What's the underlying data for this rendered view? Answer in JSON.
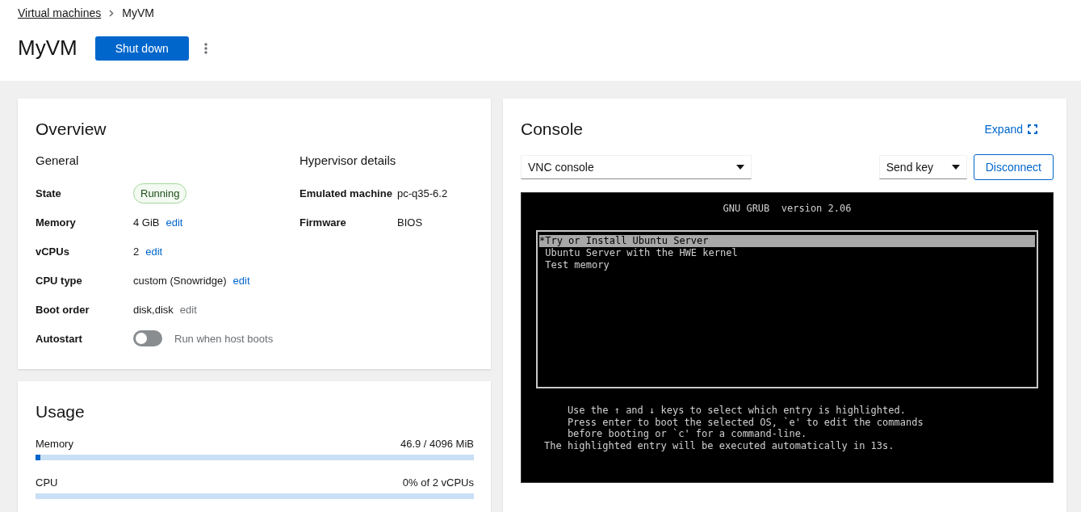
{
  "breadcrumb": [
    {
      "label": "Virtual machines",
      "kind": "link"
    },
    {
      "label": "MyVM",
      "kind": "current"
    }
  ],
  "header": {
    "title": "MyVM",
    "primary_button": "Shut down"
  },
  "overview": {
    "title": "Overview",
    "general": {
      "heading": "General",
      "rows": [
        {
          "kind": "badge",
          "label": "State",
          "value": "Running"
        },
        {
          "kind": "text",
          "label": "Memory",
          "value": "4 GiB",
          "action": "edit",
          "disabled": false
        },
        {
          "kind": "text",
          "label": "vCPUs",
          "value": "2",
          "action": "edit",
          "disabled": false
        },
        {
          "kind": "text",
          "label": "CPU type",
          "value": "custom (Snowridge)",
          "action": "edit",
          "disabled": false
        },
        {
          "kind": "text",
          "label": "Boot order",
          "value": "disk,disk",
          "action": "edit",
          "disabled": true
        },
        {
          "kind": "switch",
          "label": "Autostart",
          "value": "Run when host boots",
          "on": false
        }
      ]
    },
    "hypervisor": {
      "heading": "Hypervisor details",
      "rows": [
        {
          "label": "Emulated machine",
          "value": "pc-q35-6.2"
        },
        {
          "label": "Firmware",
          "value": "BIOS"
        }
      ]
    }
  },
  "usage": {
    "title": "Usage",
    "meters": [
      {
        "name": "Memory",
        "reading": "46.9 / 4096 MiB",
        "level": 0.011
      },
      {
        "name": "CPU",
        "reading": "0% of 2 vCPUs"
      }
    ]
  },
  "console": {
    "title": "Console",
    "expand": "Expand",
    "type_select": "VNC console",
    "send_key": "Send key",
    "disconnect": "Disconnect",
    "screen": {
      "title": "GNU GRUB  version 2.06",
      "entries": [
        {
          "label": "*Try or Install Ubuntu Server",
          "selected": true
        },
        {
          "label": " Ubuntu Server with the HWE kernel",
          "selected": false
        },
        {
          "label": " Test memory",
          "selected": false
        }
      ],
      "help": [
        "    Use the ↑ and ↓ keys to select which entry is highlighted.",
        "    Press enter to boot the selected OS, `e' to edit the commands",
        "    before booting or `c' for a command-line.",
        "The highlighted entry will be executed automatically in 13s."
      ]
    }
  }
}
